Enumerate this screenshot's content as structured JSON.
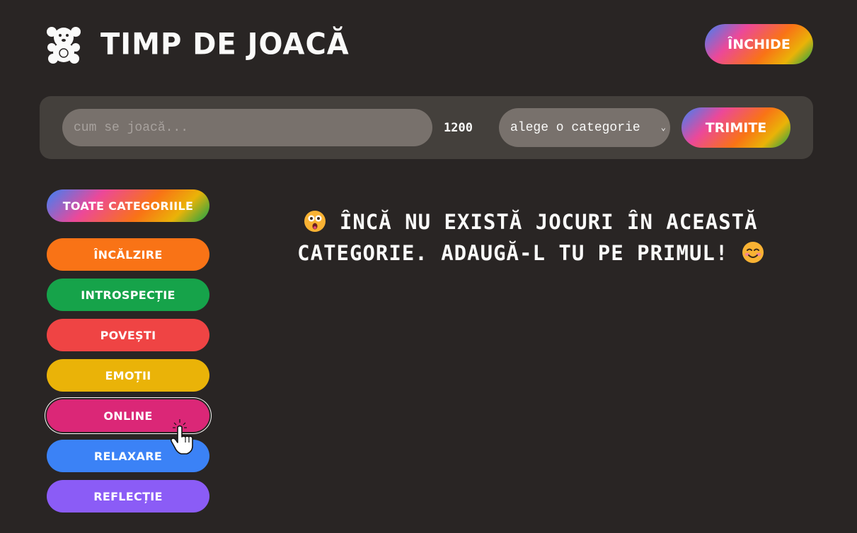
{
  "header": {
    "title": "Timp de joacă",
    "logo_icon": "teddy-bear-icon",
    "close_label": "Închide"
  },
  "form": {
    "text_placeholder": "cum se joacă...",
    "text_value": "",
    "char_count": "1200",
    "select_value": "alege o categorie",
    "submit_label": "Trimite"
  },
  "sidebar": {
    "all_label": "Toate categoriile",
    "items": [
      {
        "label": "Încălzire",
        "color": "#f97316"
      },
      {
        "label": "Introspecție",
        "color": "#16a34a"
      },
      {
        "label": "Povești",
        "color": "#ef4444"
      },
      {
        "label": "Emoții",
        "color": "#eab308"
      },
      {
        "label": "Online",
        "color": "#db2777"
      },
      {
        "label": "Relaxare",
        "color": "#3b82f6"
      },
      {
        "label": "Reflecție",
        "color": "#8b5cf6"
      }
    ]
  },
  "main": {
    "message_part1": "Încă nu există jocuri în această categorie. Adaugă-l tu pe primul!",
    "emoji_start": "astonished-face-icon",
    "emoji_end": "smiling-face-icon"
  }
}
